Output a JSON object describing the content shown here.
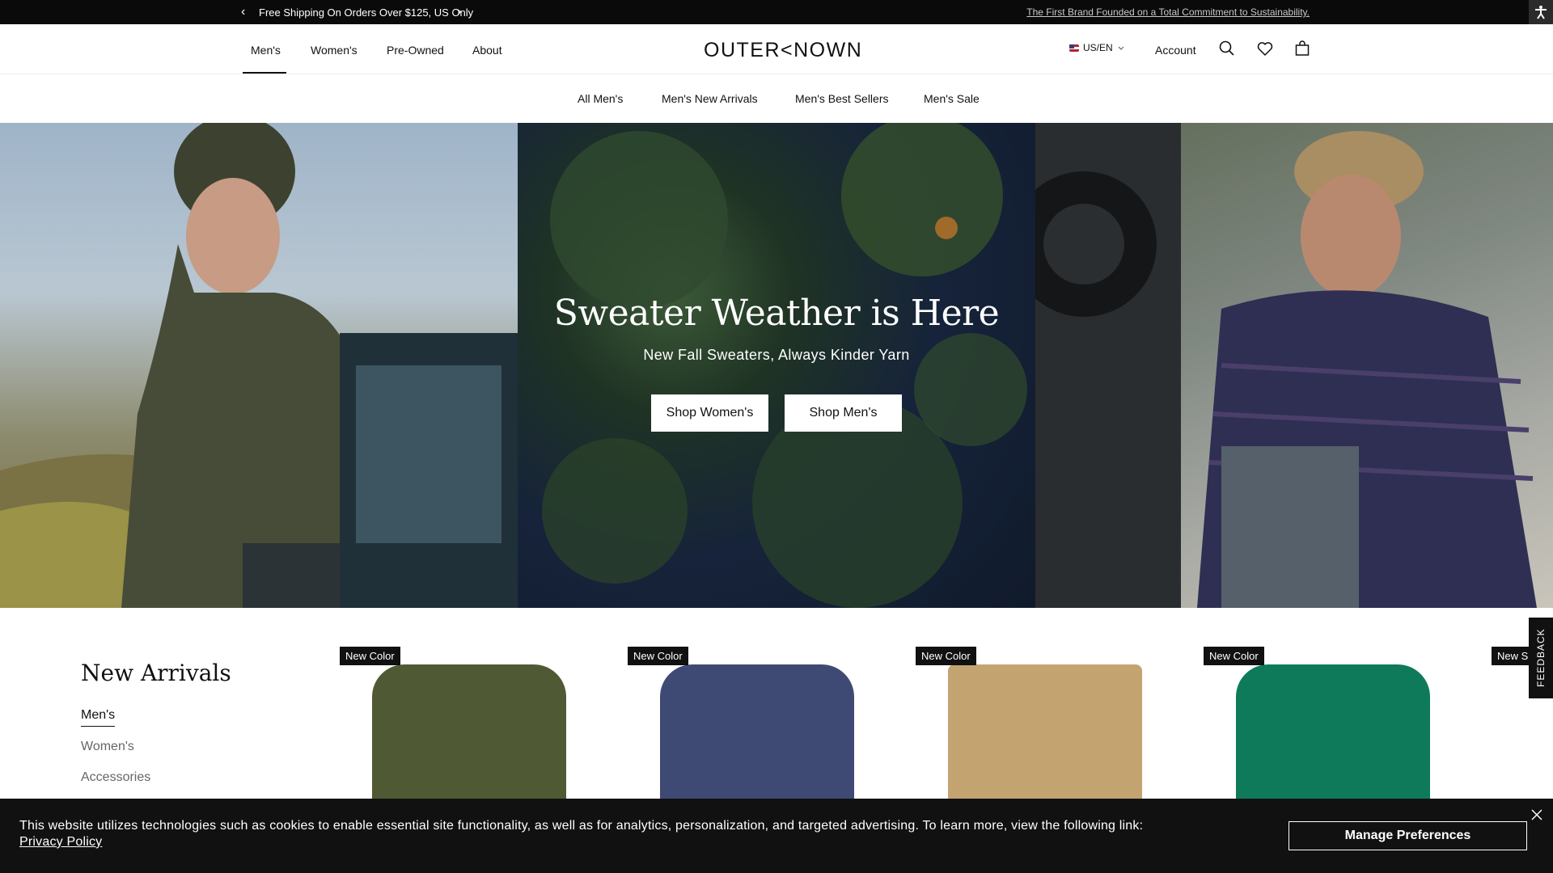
{
  "announcement": {
    "message": "Free Shipping On Orders Over $125, US Only",
    "link": "The First Brand Founded on a Total Commitment to Sustainability."
  },
  "header": {
    "nav": [
      "Men's",
      "Women's",
      "Pre-Owned",
      "About"
    ],
    "logo": "OUTER<NOWN",
    "region": "US/EN",
    "account": "Account"
  },
  "subnav": [
    "All Men's",
    "Men's New Arrivals",
    "Men's Best Sellers",
    "Men's Sale"
  ],
  "hero": {
    "title": "Sweater Weather is Here",
    "subtitle": "New Fall Sweaters, Always Kinder Yarn",
    "btn_women": "Shop Women's",
    "btn_men": "Shop Men's"
  },
  "new_arrivals": {
    "title": "New Arrivals",
    "tabs": [
      "Men's",
      "Women's",
      "Accessories"
    ],
    "products": [
      {
        "badge": "New Color",
        "color": "#4f5a35"
      },
      {
        "badge": "New Color",
        "color": "#3f4a74"
      },
      {
        "badge": "New Color",
        "color": "#c3a470"
      },
      {
        "badge": "New Color",
        "color": "#0f7a5a"
      },
      {
        "badge": "New S"
      }
    ]
  },
  "feedback": "FEEDBACK",
  "cookie": {
    "text": "This website utilizes technologies such as cookies to enable essential site functionality, as well as for analytics, personalization, and targeted advertising. To learn more, view the following link:",
    "link": "Privacy Policy",
    "button": "Manage Preferences"
  }
}
